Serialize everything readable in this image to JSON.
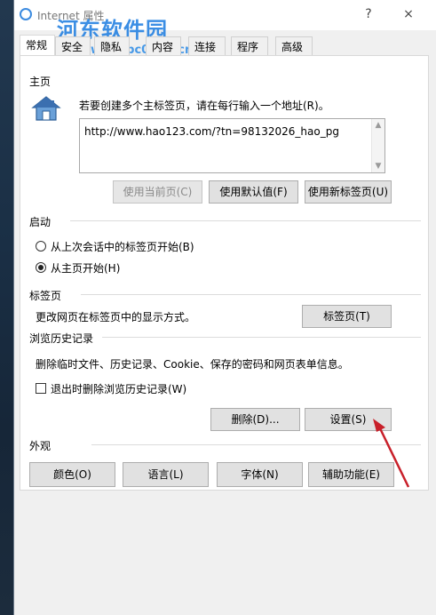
{
  "window": {
    "title": "Internet 属性",
    "help_label": "?",
    "close_label": "×"
  },
  "watermark": {
    "brand": "河东软件园",
    "url": "www.pc0359.cn"
  },
  "tabs": [
    {
      "label": "常规",
      "active": true
    },
    {
      "label": "安全",
      "active": false
    },
    {
      "label": "隐私",
      "active": false
    },
    {
      "label": "内容",
      "active": false
    },
    {
      "label": "连接",
      "active": false
    },
    {
      "label": "程序",
      "active": false
    },
    {
      "label": "高级",
      "active": false
    }
  ],
  "home": {
    "heading": "主页",
    "instruction": "若要创建多个主标签页，请在每行输入一个地址(R)。",
    "url_value": "http://www.hao123.com/?tn=98132026_hao_pg",
    "use_current_label": "使用当前页(C)",
    "use_default_label": "使用默认值(F)",
    "use_new_tab_label": "使用新标签页(U)"
  },
  "startup": {
    "heading": "启动",
    "option_last_session": "从上次会话中的标签页开始(B)",
    "option_home": "从主页开始(H)",
    "selected": "home"
  },
  "tabs_section": {
    "heading": "标签页",
    "description": "更改网页在标签页中的显示方式。",
    "button_label": "标签页(T)"
  },
  "history": {
    "heading": "浏览历史记录",
    "description": "删除临时文件、历史记录、Cookie、保存的密码和网页表单信息。",
    "checkbox_label": "退出时删除浏览历史记录(W)",
    "checkbox_checked": false,
    "delete_label": "删除(D)...",
    "settings_label": "设置(S)"
  },
  "appearance": {
    "heading": "外观",
    "colors_label": "颜色(O)",
    "languages_label": "语言(L)",
    "fonts_label": "字体(N)",
    "accessibility_label": "辅助功能(E)"
  },
  "annotation_color": "#c8202a"
}
